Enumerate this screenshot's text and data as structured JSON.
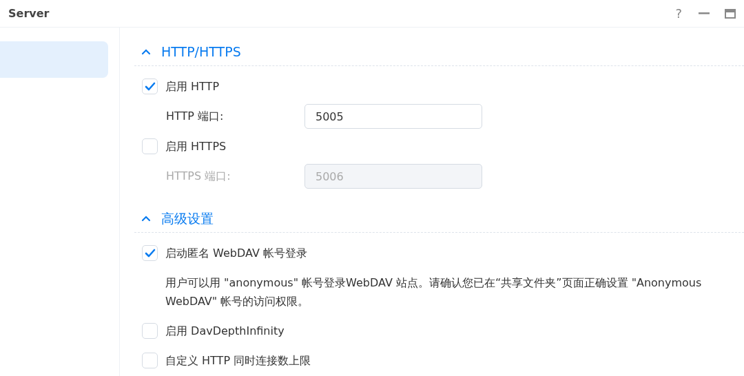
{
  "window": {
    "title": "Server",
    "help": "?"
  },
  "sidebar": {
    "items": [
      {
        "selected": true
      }
    ]
  },
  "sections": [
    {
      "title": "HTTP/HTTPS",
      "expanded": true,
      "rows": [
        {
          "kind": "checkbox",
          "label": "启用 HTTP",
          "checked": true
        },
        {
          "kind": "field",
          "label": "HTTP 端口:",
          "value": "5005",
          "disabled": false
        },
        {
          "kind": "checkbox",
          "label": "启用 HTTPS",
          "checked": false
        },
        {
          "kind": "field",
          "label": "HTTPS 端口:",
          "value": "5006",
          "disabled": true
        }
      ]
    },
    {
      "title": "高级设置",
      "expanded": true,
      "rows": [
        {
          "kind": "checkbox",
          "label": "启动匿名 WebDAV 帐号登录",
          "checked": true
        },
        {
          "kind": "note",
          "text": "用户可以用 \"anonymous\" 帐号登录WebDAV 站点。请确认您已在“共享文件夹”页面正确设置 \"Anonymous WebDAV\" 帐号的访问权限。"
        },
        {
          "kind": "checkbox",
          "label": "启用 DavDepthInfinity",
          "checked": false
        },
        {
          "kind": "checkbox",
          "label": "自定义 HTTP 同时连接数上限",
          "checked": false
        }
      ]
    }
  ]
}
